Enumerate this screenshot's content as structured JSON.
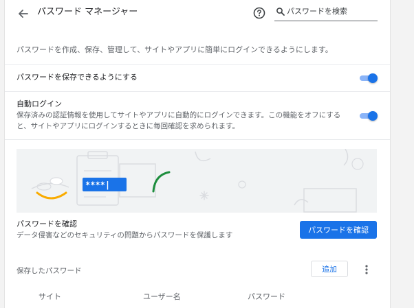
{
  "header": {
    "title": "パスワード マネージャー",
    "search_placeholder": "パスワードを検索"
  },
  "description": "パスワードを作成、保存、管理して、サイトやアプリに簡単にログインできるようにします。",
  "settings": {
    "save_passwords": {
      "label": "パスワードを保存できるようにする",
      "enabled": true
    },
    "auto_signin": {
      "title": "自動ログイン",
      "description": "保存済みの認証情報を使用してサイトやアプリに自動的にログインできます。この機能をオフにすると、サイトやアプリにログインするときに毎回確認を求められます。",
      "enabled": true
    }
  },
  "banner": {
    "password_mask": "****|"
  },
  "check": {
    "title": "パスワードを確認",
    "description": "データ侵害などのセキュリティの問題からパスワードを保護します",
    "button": "パスワードを確認"
  },
  "saved": {
    "label": "保存したパスワード",
    "add_button": "追加",
    "columns": [
      "サイト",
      "ユーザー名",
      "パスワード"
    ]
  },
  "colors": {
    "accent": "#1a73e8",
    "toggle_track": "#8ab4f8",
    "banner_bg": "#f1f3f4"
  }
}
